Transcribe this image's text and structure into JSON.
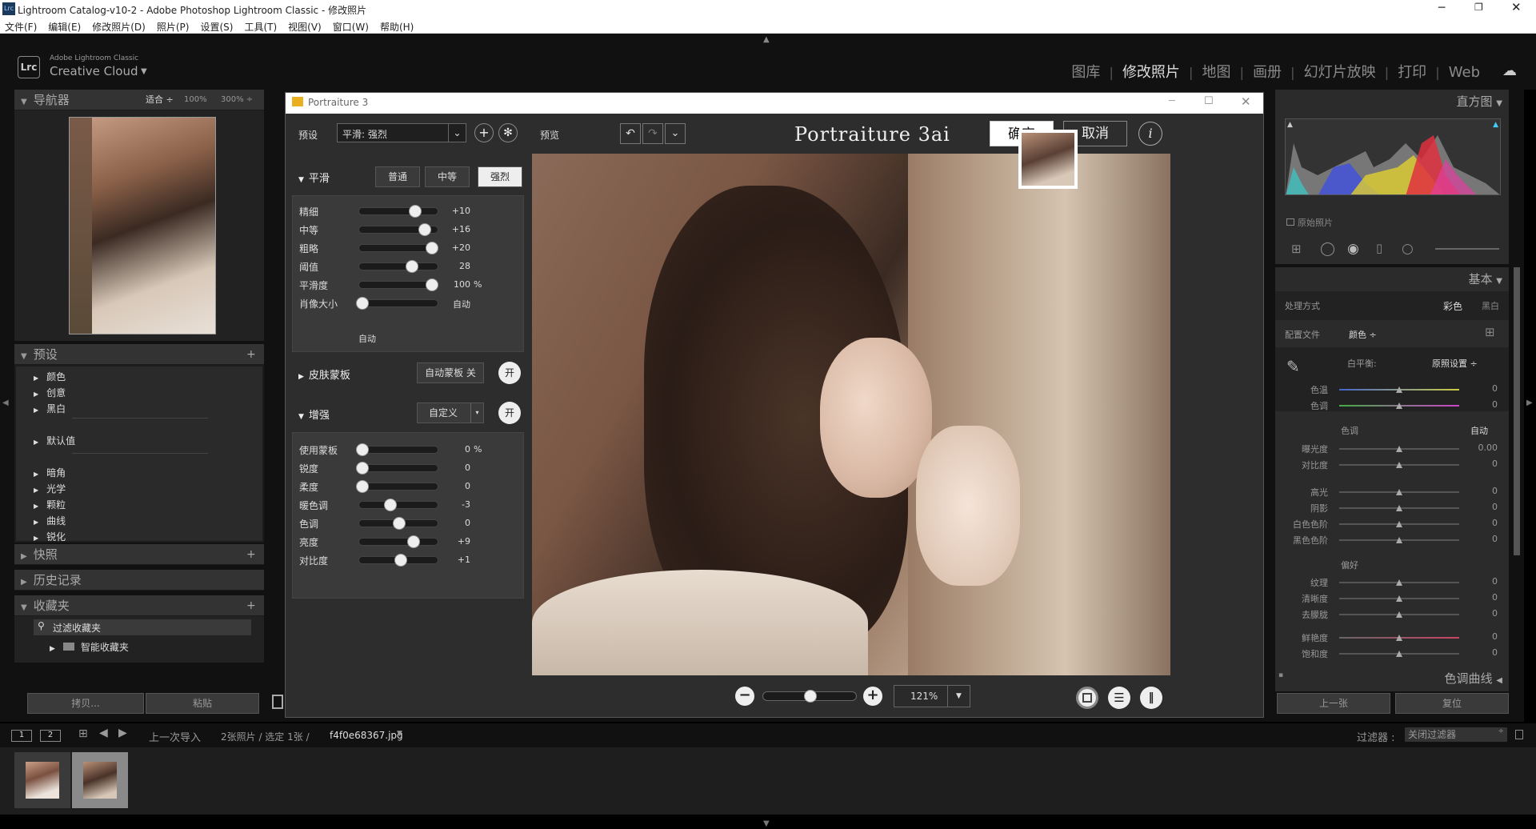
{
  "window": {
    "title": "Lightroom Catalog-v10-2 - Adobe Photoshop Lightroom Classic - 修改照片",
    "icon": "Lrc"
  },
  "menu": [
    "文件(F)",
    "编辑(E)",
    "修改照片(D)",
    "照片(P)",
    "设置(S)",
    "工具(T)",
    "视图(V)",
    "窗口(W)",
    "帮助(H)"
  ],
  "brand": {
    "line1": "Adobe Lightroom Classic",
    "line2": "Creative Cloud",
    "badge": "Lrc"
  },
  "modules": [
    "图库",
    "修改照片",
    "地图",
    "画册",
    "幻灯片放映",
    "打印",
    "Web"
  ],
  "left": {
    "navigator": {
      "title": "导航器",
      "zoom": [
        "适合 ÷",
        "100%",
        "300% ÷"
      ]
    },
    "presets": {
      "title": "预设",
      "items": [
        "颜色",
        "创意",
        "黑白",
        "默认值",
        "暗角",
        "光学",
        "颗粒",
        "曲线",
        "锐化"
      ]
    },
    "snapshots": "快照",
    "history": "历史记录",
    "collections": {
      "title": "收藏夹",
      "filter": "过滤收藏夹",
      "smart": "智能收藏夹"
    },
    "copy": "拷贝...",
    "paste": "粘贴"
  },
  "plugin": {
    "title": "Portraiture 3",
    "preset_label": "预设",
    "preset_value": "平滑: 强烈",
    "preview": "预览",
    "logo": "Portraiture 3ai",
    "ok": "确定",
    "cancel": "取消",
    "info": "i",
    "smooth": {
      "title": "平滑",
      "modes": [
        "普通",
        "中等",
        "强烈"
      ],
      "sliders": [
        {
          "label": "精细",
          "value": "+10",
          "pos": 0.72
        },
        {
          "label": "中等",
          "value": "+16",
          "pos": 0.85
        },
        {
          "label": "粗略",
          "value": "+20",
          "pos": 0.95
        },
        {
          "label": "阈值",
          "value": "28",
          "pos": 0.67
        },
        {
          "label": "平滑度",
          "value": "100",
          "unit": "%",
          "pos": 0.95
        },
        {
          "label": "肖像大小",
          "value": "自动",
          "pos": 0.0
        }
      ],
      "auto": "自动"
    },
    "skin": {
      "title": "皮肤蒙板",
      "btn": "自动蒙板 关",
      "on": "开"
    },
    "enhance": {
      "title": "增强",
      "mode": "自定义",
      "on": "开",
      "sliders": [
        {
          "label": "使用蒙板",
          "value": "0",
          "unit": "%",
          "pos": 0.0
        },
        {
          "label": "锐度",
          "value": "0",
          "pos": 0.0
        },
        {
          "label": "柔度",
          "value": "0",
          "pos": 0.0
        },
        {
          "label": "暖色调",
          "value": "-3",
          "pos": 0.38
        },
        {
          "label": "色调",
          "value": "0",
          "pos": 0.5
        },
        {
          "label": "亮度",
          "value": "+9",
          "pos": 0.7
        },
        {
          "label": "对比度",
          "value": "+1",
          "pos": 0.52
        }
      ]
    },
    "zoom": "121%"
  },
  "right": {
    "histogram": "直方图",
    "original": "原始照片",
    "basic": "基本",
    "treatment": {
      "label": "处理方式",
      "color": "彩色",
      "bw": "黑白"
    },
    "profile": {
      "label": "配置文件",
      "value": "颜色 ÷"
    },
    "wb": {
      "label": "白平衡:",
      "value": "原照设置 ÷"
    },
    "temp": {
      "label": "色温",
      "value": "0"
    },
    "tint": {
      "label": "色调",
      "value": "0"
    },
    "tone": "色调",
    "auto": "自动",
    "tone_rows": [
      {
        "label": "曝光度",
        "value": "0.00"
      },
      {
        "label": "对比度",
        "value": "0"
      },
      {
        "label": "高光",
        "value": "0"
      },
      {
        "label": "阴影",
        "value": "0"
      },
      {
        "label": "白色色阶",
        "value": "0"
      },
      {
        "label": "黑色色阶",
        "value": "0"
      }
    ],
    "presence": "偏好",
    "presence_rows": [
      {
        "label": "纹理",
        "value": "0"
      },
      {
        "label": "清晰度",
        "value": "0"
      },
      {
        "label": "去朦胧",
        "value": "0"
      },
      {
        "label": "鲜艳度",
        "value": "0"
      },
      {
        "label": "饱和度",
        "value": "0"
      }
    ],
    "curve": "色调曲线",
    "prev": "上一张",
    "reset": "复位"
  },
  "filmstrip": {
    "source": "上一次导入",
    "count": "2张照片 / 选定 1张 /",
    "file": "f4f0e68367.jpg",
    "filter_label": "过滤器 :",
    "filter_value": "关闭过滤器",
    "p1": "1",
    "p2": "2"
  }
}
